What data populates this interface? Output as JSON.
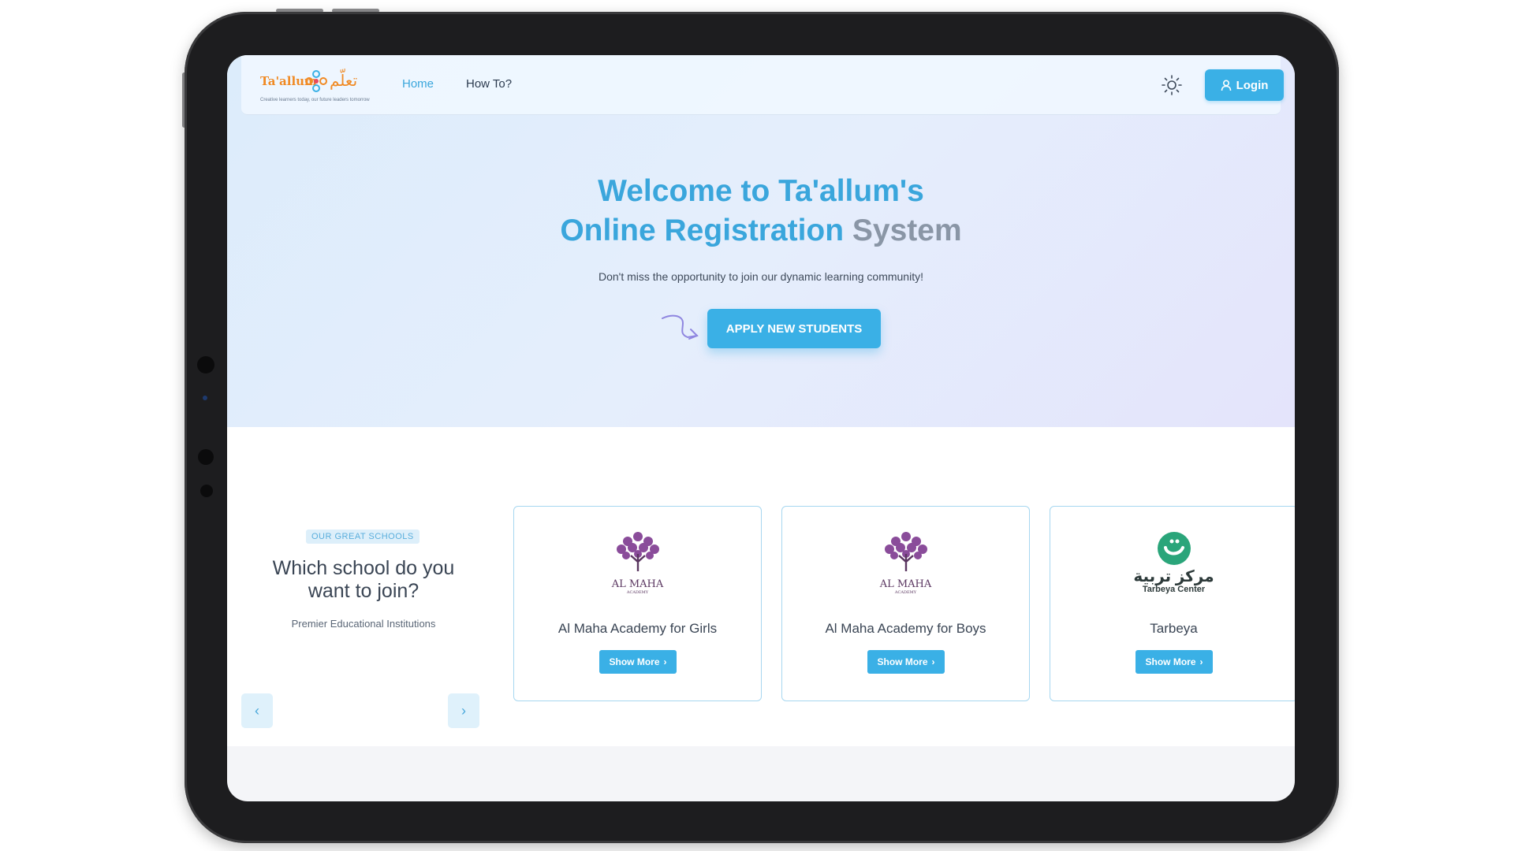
{
  "navbar": {
    "logo_text_en": "Ta'allum",
    "logo_text_ar": "تعلّم",
    "logo_tagline": "Creative learners today, our future leaders tomorrow",
    "links": [
      {
        "label": "Home",
        "active": true
      },
      {
        "label": "How To?",
        "active": false
      }
    ],
    "login_label": "Login"
  },
  "hero": {
    "title_line1": "Welcome to Ta'allum's",
    "title_line2_a": "Online Registration ",
    "title_line2_b": "System",
    "subtitle": "Don't miss the opportunity to join our dynamic learning community!",
    "apply_label": "APPLY NEW STUDENTS"
  },
  "schools": {
    "badge": "OUR GREAT SCHOOLS",
    "heading": "Which school do you want to join?",
    "subheading": "Premier Educational Institutions",
    "cards": [
      {
        "name": "Al Maha Academy for Girls",
        "logo_text": "AL MAHA",
        "logo_sub": "ACADEMY",
        "button": "Show More"
      },
      {
        "name": "Al Maha Academy for Boys",
        "logo_text": "AL MAHA",
        "logo_sub": "ACADEMY",
        "button": "Show More"
      },
      {
        "name": "Tarbeya",
        "logo_text_ar": "مركز تربية",
        "logo_text_en": "Tarbeya Center",
        "button": "Show More"
      }
    ]
  },
  "colors": {
    "accent": "#3ab0e6",
    "title": "#3aa6dc",
    "maha_purple": "#7a3f8a",
    "tarbeya_green": "#2aa57a"
  }
}
